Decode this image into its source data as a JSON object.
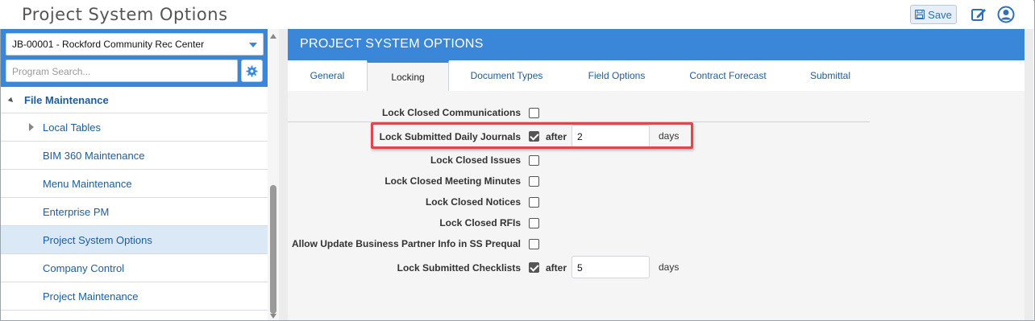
{
  "app": {
    "title": "Project System Options",
    "save_label": "Save"
  },
  "sidebar": {
    "job_select_value": "JB-00001 - Rockford Community Rec Center",
    "search_placeholder": "Program Search...",
    "section_label": "File Maintenance",
    "items": [
      {
        "label": "Local Tables",
        "expandable": true,
        "active": false
      },
      {
        "label": "BIM 360 Maintenance",
        "expandable": false,
        "active": false
      },
      {
        "label": "Menu Maintenance",
        "expandable": false,
        "active": false
      },
      {
        "label": "Enterprise PM",
        "expandable": false,
        "active": false
      },
      {
        "label": "Project System Options",
        "expandable": false,
        "active": true
      },
      {
        "label": "Company Control",
        "expandable": false,
        "active": false
      },
      {
        "label": "Project Maintenance",
        "expandable": false,
        "active": false
      }
    ]
  },
  "main": {
    "header_title": "PROJECT SYSTEM OPTIONS",
    "tabs": [
      {
        "label": "General",
        "active": false
      },
      {
        "label": "Locking",
        "active": true
      },
      {
        "label": "Document Types",
        "active": false
      },
      {
        "label": "Field Options",
        "active": false
      },
      {
        "label": "Contract Forecast",
        "active": false
      },
      {
        "label": "Submittal",
        "active": false
      }
    ],
    "options": [
      {
        "label": "Lock Closed Communications",
        "checked": false
      },
      {
        "label": "Lock Submitted Daily Journals",
        "checked": true,
        "after_label": "after",
        "days_value": "2",
        "days_label": "days"
      },
      {
        "label": "Lock Closed Issues",
        "checked": false
      },
      {
        "label": "Lock Closed Meeting Minutes",
        "checked": false
      },
      {
        "label": "Lock Closed Notices",
        "checked": false
      },
      {
        "label": "Lock Closed RFIs",
        "checked": false
      },
      {
        "label": "Allow Update Business Partner Info in SS Prequal",
        "checked": false
      },
      {
        "label": "Lock Submitted Checklists",
        "checked": true,
        "after_label": "after",
        "days_value": "5",
        "days_label": "days"
      }
    ]
  },
  "colors": {
    "accent": "#3a86d9",
    "link": "#1d5c9d",
    "highlight_box": "#e0464c"
  },
  "icons": {
    "save": "save-icon",
    "edit": "edit-icon",
    "user": "user-icon",
    "gear": "gear-icon"
  }
}
